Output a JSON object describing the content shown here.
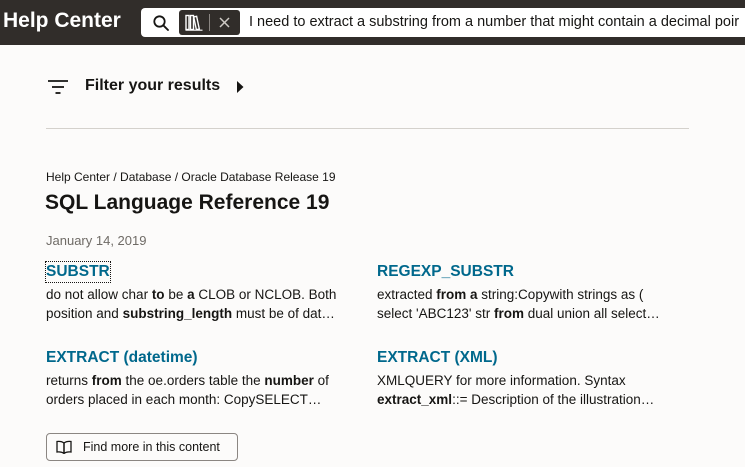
{
  "header": {
    "brand": "Help Center",
    "search": {
      "query": "I need to extract a substring from a number that might contain a decimal poir"
    }
  },
  "filter": {
    "label": "Filter your results"
  },
  "content": {
    "breadcrumb": "Help Center / Database / Oracle Database Release 19",
    "title": "SQL Language Reference 19",
    "date": "January 14, 2019"
  },
  "results": [
    {
      "title": "SUBSTR",
      "line1": [
        {
          "t": "do not allow char ",
          "b": false
        },
        {
          "t": "to",
          "b": true
        },
        {
          "t": " be ",
          "b": false
        },
        {
          "t": "a",
          "b": true
        },
        {
          "t": " CLOB or NCLOB. Both",
          "b": false
        }
      ],
      "line2": [
        {
          "t": "position and ",
          "b": false
        },
        {
          "t": "substring_length",
          "b": true
        },
        {
          "t": " must be of dat…",
          "b": false
        }
      ]
    },
    {
      "title": "REGEXP_SUBSTR",
      "line1": [
        {
          "t": "extracted ",
          "b": false
        },
        {
          "t": "from a",
          "b": true
        },
        {
          "t": " string:Copywith strings as (",
          "b": false
        }
      ],
      "line2": [
        {
          "t": "select 'ABC123' str ",
          "b": false
        },
        {
          "t": "from",
          "b": true
        },
        {
          "t": " dual union all select…",
          "b": false
        }
      ]
    },
    {
      "title": "EXTRACT (datetime)",
      "line1": [
        {
          "t": "returns ",
          "b": false
        },
        {
          "t": "from",
          "b": true
        },
        {
          "t": " the oe.orders table the ",
          "b": false
        },
        {
          "t": "number",
          "b": true
        },
        {
          "t": " of",
          "b": false
        }
      ],
      "line2": [
        {
          "t": "orders placed in each month: CopySELECT…",
          "b": false
        }
      ]
    },
    {
      "title": "EXTRACT (XML)",
      "line1": [
        {
          "t": "XMLQUERY for more information. Syntax",
          "b": false
        }
      ],
      "line2": [
        {
          "t": "extract_xml",
          "b": true
        },
        {
          "t": "::= Description of the illustration…",
          "b": false
        }
      ]
    }
  ],
  "find_more": {
    "label": "Find more in this content"
  },
  "colors": {
    "header_bg": "#312d2a",
    "link": "#00688c",
    "page_bg": "#fcfbfa"
  },
  "icons": [
    "search-icon",
    "book-icon",
    "close-icon",
    "filter-icon",
    "caret-right-icon",
    "open-book-icon"
  ]
}
